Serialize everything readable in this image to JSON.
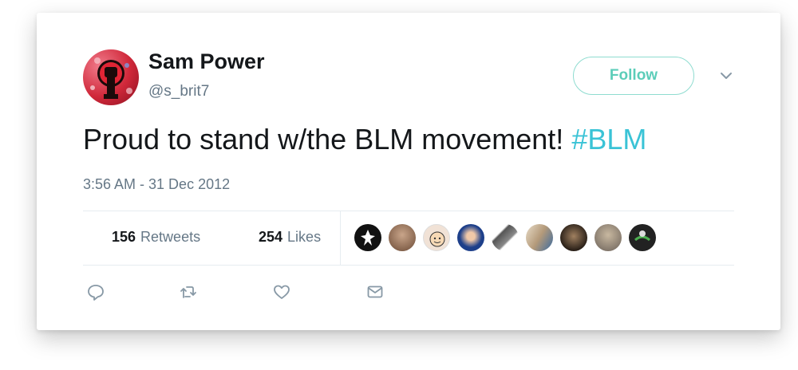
{
  "user": {
    "display_name": "Sam Power",
    "handle": "@s_brit7"
  },
  "follow_button": {
    "label": "Follow"
  },
  "tweet": {
    "text": "Proud to stand w/the BLM movement! ",
    "hashtag": "#BLM",
    "timestamp": "3:56 AM - 31 Dec 2012"
  },
  "stats": {
    "retweets_count": "156",
    "retweets_label": "Retweets",
    "likes_count": "254",
    "likes_label": "Likes"
  },
  "likers": [
    {
      "icon": "liker-avatar-1",
      "color": "#111111"
    },
    {
      "icon": "liker-avatar-2",
      "color": "#8a6a55"
    },
    {
      "icon": "liker-avatar-3",
      "color": "#e9d6c8"
    },
    {
      "icon": "liker-avatar-4",
      "color": "#1d3f8a"
    },
    {
      "icon": "liker-avatar-5",
      "color": "#6b6b6b"
    },
    {
      "icon": "liker-avatar-6",
      "color": "#c8b9a5"
    },
    {
      "icon": "liker-avatar-7",
      "color": "#3c3026"
    },
    {
      "icon": "liker-avatar-8",
      "color": "#9a8f80"
    },
    {
      "icon": "liker-avatar-9",
      "color": "#2a2a2a"
    }
  ],
  "actions": [
    "reply-icon",
    "retweet-icon",
    "like-icon",
    "direct-message-icon"
  ],
  "colors": {
    "accent": "#5ccdb9",
    "hashtag": "#3ac3d6",
    "text": "#14171a",
    "muted": "#657786"
  }
}
